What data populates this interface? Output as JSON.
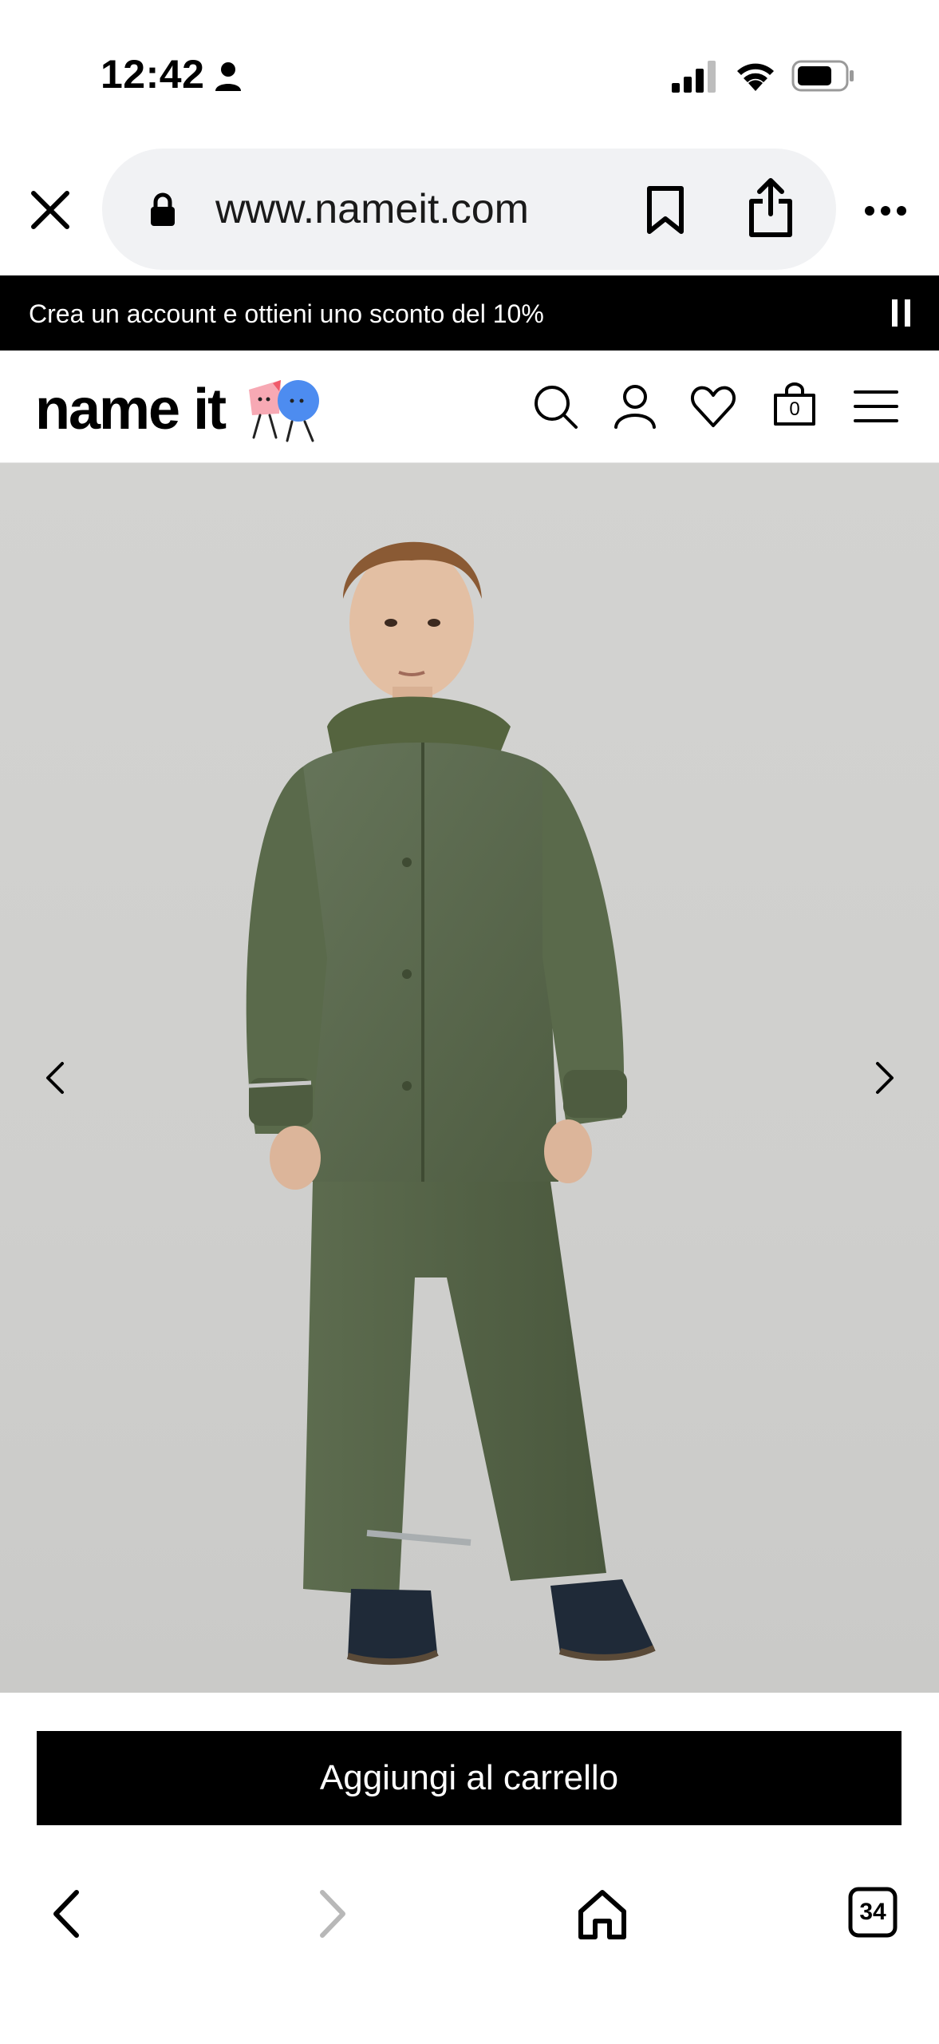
{
  "status_bar": {
    "time": "12:42"
  },
  "browser": {
    "url": "www.nameit.com",
    "tab_count": "34"
  },
  "promo_banner": {
    "text": "Crea un account e ottieni uno sconto del 10%"
  },
  "header": {
    "logo_text": "name it",
    "cart_count": "0",
    "icons": [
      "search-icon",
      "account-icon",
      "heart-icon",
      "bag-icon",
      "hamburger-menu-icon"
    ]
  },
  "product": {
    "add_to_cart_label": "Aggiungi al carrello"
  },
  "colors": {
    "banner_bg": "#000000",
    "button_bg": "#000000",
    "raincoat": "#5b6b4a",
    "background": "#d3d3d1"
  }
}
